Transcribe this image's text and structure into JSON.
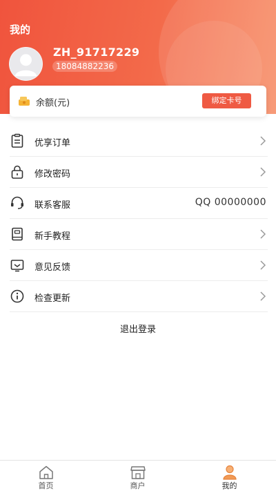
{
  "header": {
    "title": "我的",
    "username": "ZH_91717229",
    "phone": "18084882236"
  },
  "balance": {
    "label": "余额(元)",
    "bind_button": "绑定卡号"
  },
  "menu": {
    "items": [
      {
        "label": "优享订单",
        "icon": "order-icon",
        "trailing": "chevron"
      },
      {
        "label": "修改密码",
        "icon": "lock-icon",
        "trailing": "chevron"
      },
      {
        "label": "联系客服",
        "icon": "headset-icon",
        "trailing": "QQ 00000000"
      },
      {
        "label": "新手教程",
        "icon": "book-icon",
        "trailing": "chevron"
      },
      {
        "label": "意见反馈",
        "icon": "feedback-icon",
        "trailing": "chevron"
      },
      {
        "label": "检查更新",
        "icon": "info-icon",
        "trailing": "chevron"
      }
    ]
  },
  "logout": "退出登录",
  "tabbar": {
    "items": [
      {
        "label": "首页",
        "icon": "home-icon",
        "active": false
      },
      {
        "label": "商户",
        "icon": "store-icon",
        "active": false
      },
      {
        "label": "我的",
        "icon": "user-icon",
        "active": true
      }
    ]
  },
  "colors": {
    "accent": "#ef5a43",
    "header_start": "#f0543d",
    "header_end": "#f7906a",
    "tab_active_icon": "#f29a55"
  }
}
